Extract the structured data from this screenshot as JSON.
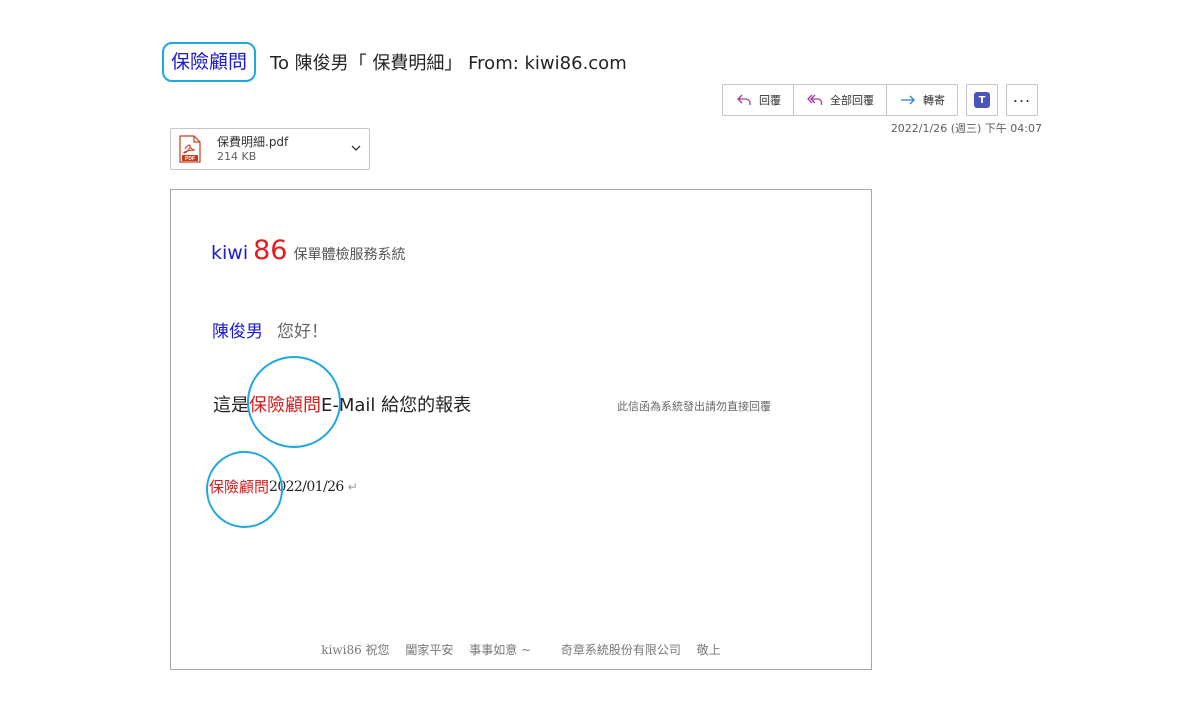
{
  "subject": {
    "tag": "保險顧問",
    "text": "To 陳俊男「 保費明細」 From: kiwi86.com"
  },
  "toolbar": {
    "reply_label": "回覆",
    "reply_all_label": "全部回覆",
    "forward_label": "轉寄",
    "teams_letter": "T"
  },
  "date": "2022/1/26 (週三) 下午 04:07",
  "attachment": {
    "name": "保費明細.pdf",
    "size": "214 KB",
    "badge": "PDF"
  },
  "message": {
    "logo_kiwi": "kiwi",
    "logo_86": "86",
    "logo_sub": "保單體檢服務系統",
    "recipient_name": "陳俊男",
    "hello": "您好！",
    "intro_pre": "這是",
    "intro_highlight": "保險顧問",
    "intro_post": "E-Mail 給您的報表",
    "notice": "此信函為系統發出請勿直接回覆",
    "sign_name": "保險顧問",
    "sign_date": "2022/01/26",
    "return_mark": "↵",
    "footer": [
      "kiwi86 祝您",
      "闔家平安",
      "事事如意 ~",
      "奇章系統股份有限公司",
      "敬上"
    ]
  },
  "colors": {
    "highlight_circle": "#1ea7e1",
    "brand_blue": "#1a1ad2",
    "brand_red": "#e31d1d"
  }
}
